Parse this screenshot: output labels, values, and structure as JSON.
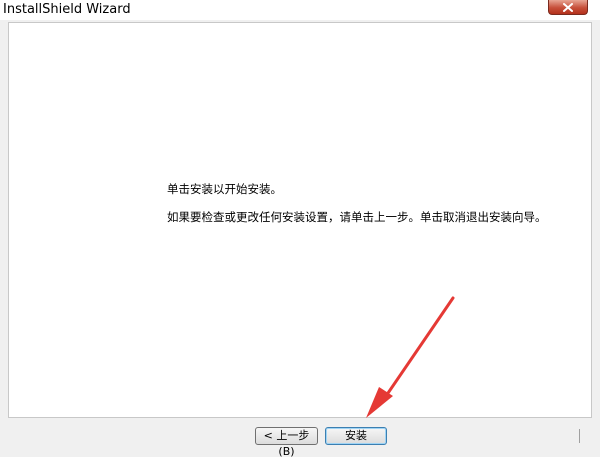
{
  "window": {
    "title": "InstallShield Wizard",
    "close_icon": "close-icon"
  },
  "content": {
    "line1": "单击安装以开始安装。",
    "line2": "如果要检查或更改任何安装设置，请单击上一步。单击取消退出安装向导。"
  },
  "buttons": {
    "back_label": "< 上一步(B)",
    "install_label": "安装"
  },
  "annotation": {
    "arrow_color": "#e53935",
    "icon": "red-arrow-icon"
  }
}
